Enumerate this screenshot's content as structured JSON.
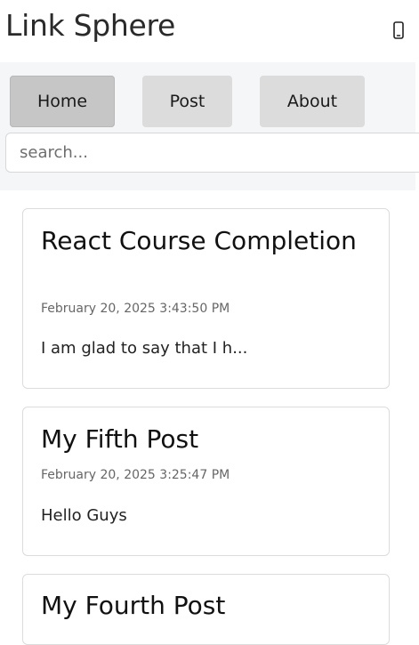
{
  "header": {
    "title": "Link Sphere",
    "device_icon": "mobile-phone-icon"
  },
  "nav": {
    "items": [
      {
        "label": "Home",
        "active": true
      },
      {
        "label": "Post",
        "active": false
      },
      {
        "label": "About",
        "active": false
      }
    ]
  },
  "search": {
    "placeholder": "search...",
    "value": ""
  },
  "posts": [
    {
      "title": "React Course Completion",
      "date": "February 20, 2025 3:43:50 PM",
      "excerpt": "I am glad to say that I h..."
    },
    {
      "title": "My Fifth Post",
      "date": "February 20, 2025 3:25:47 PM",
      "excerpt": "Hello Guys"
    },
    {
      "title": "My Fourth Post",
      "date": "",
      "excerpt": ""
    }
  ],
  "colors": {
    "nav_background": "#f5f6f8",
    "nav_button": "#dcdcdc",
    "nav_button_active": "#c6c6c6",
    "card_border": "#dcdcdc"
  }
}
